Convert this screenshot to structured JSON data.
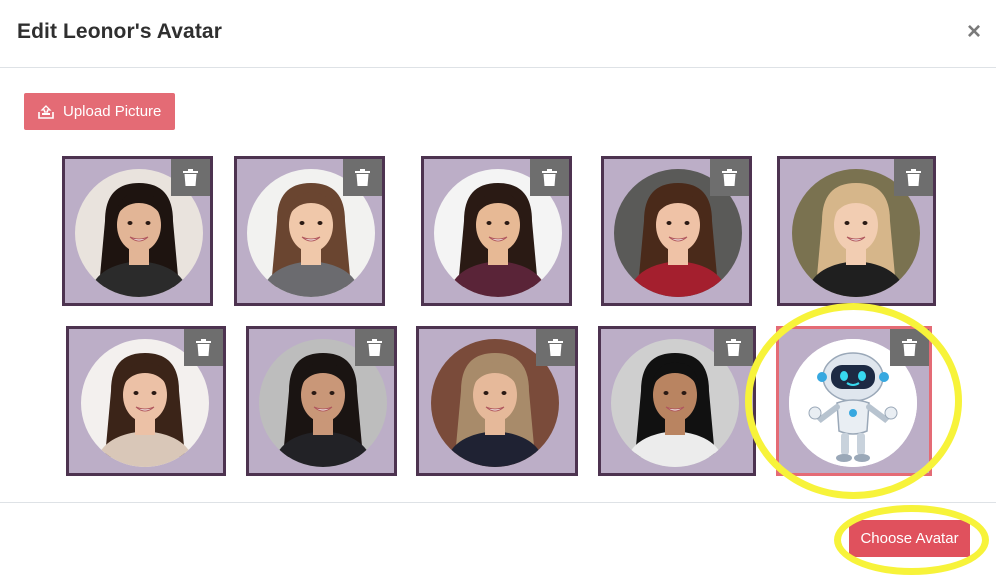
{
  "modal": {
    "title": "Edit Leonor's Avatar",
    "close_glyph": "×"
  },
  "upload": {
    "label": "Upload Picture",
    "icon": "upload-icon"
  },
  "avatars": [
    {
      "name": "avatar-1",
      "bg": "#e9e3dd",
      "hair": "#1e1410",
      "skin": "#e2b596",
      "shirt": "#2b2b2b",
      "selected": false
    },
    {
      "name": "avatar-2",
      "bg": "#f2f2f0",
      "hair": "#6a4530",
      "skin": "#f0c8aa",
      "shirt": "#6b6b6f",
      "selected": false
    },
    {
      "name": "avatar-3",
      "bg": "#f4f4f4",
      "hair": "#2a1a14",
      "skin": "#e7b995",
      "shirt": "#5a2438",
      "selected": false
    },
    {
      "name": "avatar-4",
      "bg": "#5a5a58",
      "hair": "#4a2a1a",
      "skin": "#efc2a6",
      "shirt": "#a41f2e",
      "selected": false
    },
    {
      "name": "avatar-5",
      "bg": "#7a7250",
      "hair": "#d6b68a",
      "skin": "#f2cdb2",
      "shirt": "#1f1f1f",
      "selected": false
    },
    {
      "name": "avatar-6",
      "bg": "#f3f0ee",
      "hair": "#3b2418",
      "skin": "#ecc1a6",
      "shirt": "#d9c7b8",
      "selected": false
    },
    {
      "name": "avatar-7",
      "bg": "#bdbdbd",
      "hair": "#1a1412",
      "skin": "#c99778",
      "shirt": "#222226",
      "selected": false
    },
    {
      "name": "avatar-8",
      "bg": "#7a4b3a",
      "hair": "#a88b6a",
      "skin": "#e6b99a",
      "shirt": "#1f2233",
      "selected": false
    },
    {
      "name": "avatar-9",
      "bg": "#cfcfcf",
      "hair": "#111111",
      "skin": "#b98461",
      "shirt": "#ececec",
      "selected": false
    },
    {
      "name": "avatar-robot",
      "bg": "#ffffff",
      "selected": true
    }
  ],
  "footer": {
    "choose_label": "Choose Avatar"
  },
  "colors": {
    "primary": "#e46b75",
    "tile_bg": "#bcaec7",
    "tile_border": "#4d3350",
    "highlight": "#f7f33a"
  }
}
